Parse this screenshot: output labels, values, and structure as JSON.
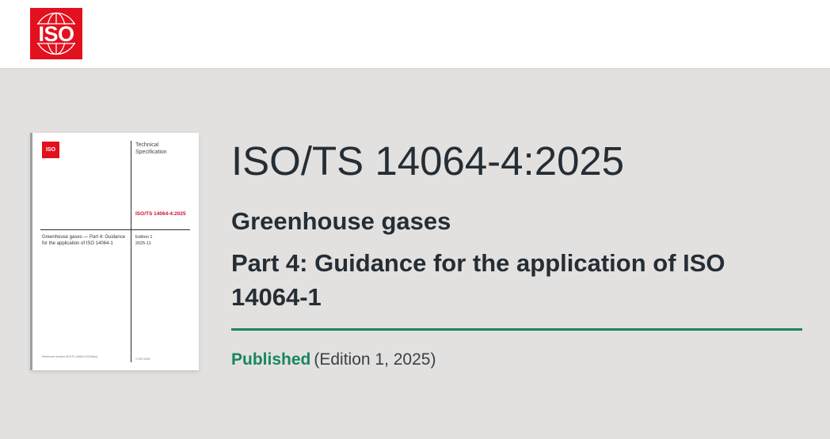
{
  "header": {
    "logo_text": "ISO"
  },
  "cover": {
    "logo_text": "ISO",
    "kind": "Technical Specification",
    "code": "ISO/TS 14064-4:2025",
    "title": "Greenhouse gases — Part 4: Guidance for the application of ISO 14064-1",
    "edition": "Edition 1",
    "date": "2025-11",
    "footer_left": "Reference number ISO/TS 14064-4:2025(en)",
    "footer_right": "© ISO 2025"
  },
  "standard": {
    "id": "ISO/TS 14064-4:2025",
    "subject": "Greenhouse gases",
    "part": "Part 4: Guidance for the application of ISO 14064-1",
    "status": "Published",
    "edition_info": "(Edition 1, 2025)"
  },
  "colors": {
    "brand_red": "#e3101e",
    "status_green": "#18865f",
    "page_bg": "#e2e1df"
  }
}
